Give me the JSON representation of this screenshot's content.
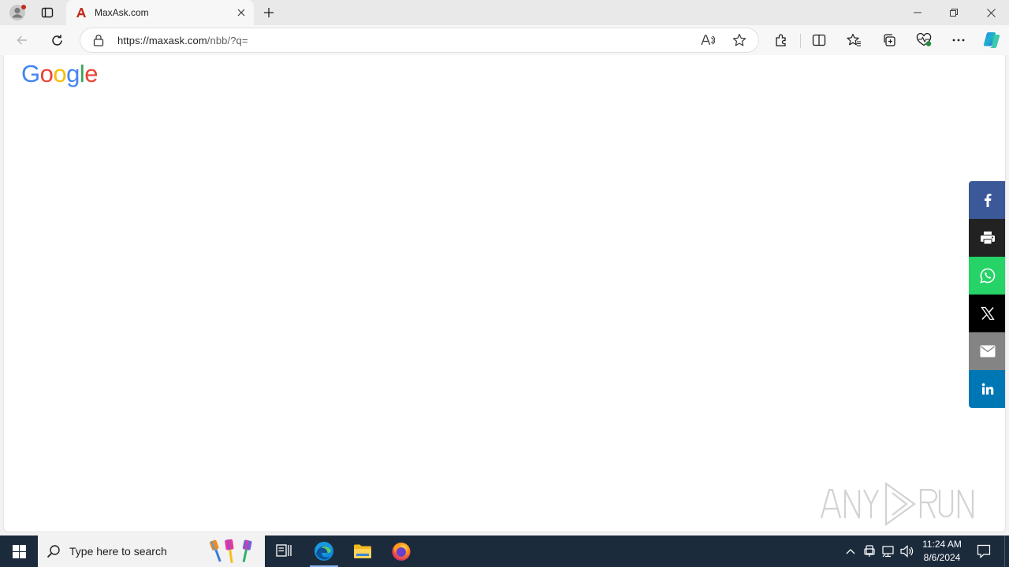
{
  "browser": {
    "tab": {
      "title": "MaxAsk.com",
      "favicon_icon": "maxask-a-icon"
    },
    "address": {
      "url_host": "https://maxask.com",
      "url_path": "/nbb/?q="
    },
    "icons": [
      "profile-icon",
      "tab-actions-icon",
      "close-icon",
      "plus-icon",
      "minimize-icon",
      "restore-icon",
      "window-close-icon",
      "back-icon",
      "refresh-icon",
      "lock-icon",
      "read-aloud-icon",
      "favorite-star-icon",
      "extensions-icon",
      "split-screen-icon",
      "favorites-icon",
      "collections-icon",
      "browser-essentials-icon",
      "more-icon",
      "copilot-icon"
    ]
  },
  "page": {
    "logo": {
      "letters": [
        "G",
        "o",
        "o",
        "g",
        "l",
        "e"
      ],
      "colors": [
        "#4285F4",
        "#EA4335",
        "#FBBC05",
        "#4285F4",
        "#34A853",
        "#EA4335"
      ]
    },
    "share_buttons": [
      {
        "name": "facebook-share-button",
        "icon": "facebook-icon",
        "color": "#3b5998"
      },
      {
        "name": "print-share-button",
        "icon": "print-icon",
        "color": "#222222"
      },
      {
        "name": "whatsapp-share-button",
        "icon": "whatsapp-icon",
        "color": "#25d366"
      },
      {
        "name": "x-share-button",
        "icon": "x-icon",
        "color": "#000000"
      },
      {
        "name": "email-share-button",
        "icon": "email-icon",
        "color": "#848484"
      },
      {
        "name": "linkedin-share-button",
        "icon": "linkedin-icon",
        "color": "#0077b5"
      }
    ],
    "watermark_icon": "anyrun-logo"
  },
  "taskbar": {
    "search_placeholder": "Type here to search",
    "clock": {
      "time": "11:24 AM",
      "date": "8/6/2024"
    },
    "apps": [
      "task-view-icon",
      "edge-icon",
      "file-explorer-icon",
      "firefox-icon"
    ],
    "tray_icons": [
      "chevron-up-icon",
      "device-icon",
      "network-icon",
      "volume-icon",
      "notification-icon"
    ]
  }
}
